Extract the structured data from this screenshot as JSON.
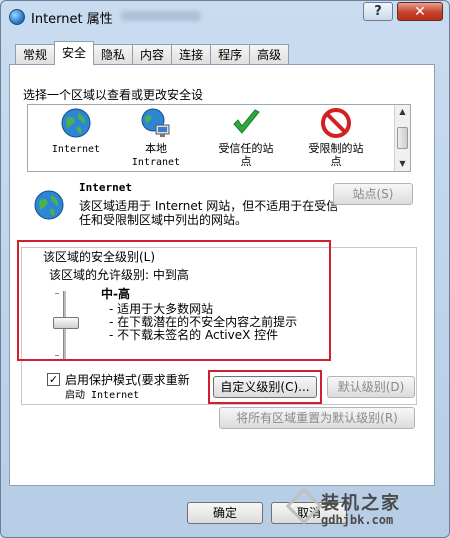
{
  "window": {
    "title": "Internet 属性"
  },
  "tabs": [
    {
      "label": "常规"
    },
    {
      "label": "安全"
    },
    {
      "label": "隐私"
    },
    {
      "label": "内容"
    },
    {
      "label": "连接"
    },
    {
      "label": "程序"
    },
    {
      "label": "高级"
    }
  ],
  "zones": {
    "prompt": "选择一个区域以查看或更改安全设",
    "items": [
      {
        "line1": "Internet",
        "line2": ""
      },
      {
        "line1": "本地",
        "line2": "Intranet"
      },
      {
        "line1": "受信任的站",
        "line2": "点"
      },
      {
        "line1": "受限制的站",
        "line2": "点"
      }
    ]
  },
  "zone_detail": {
    "title": "Internet",
    "text": "该区域适用于 Internet 网站，但不适用于在受信任和受限制区域中列出的网站。",
    "sites_button": "站点(S)"
  },
  "security_level": {
    "group_label": "该区域的安全级别(L)",
    "allowed": "该区域的允许级别: 中到高",
    "level": "中-高",
    "lines": [
      "适用于大多数网站",
      "在下载潜在的不安全内容之前提示",
      "不下载未签名的 ActiveX 控件"
    ]
  },
  "protected_mode": {
    "checked": true,
    "label_line1": "启用保护模式(要求重新",
    "label_line2": "启动 Internet"
  },
  "buttons": {
    "custom_level": "自定义级别(C)...",
    "default_level": "默认级别(D)",
    "reset_all": "将所有区域重置为默认级别(R)",
    "ok": "确定",
    "cancel": "取消"
  },
  "watermark": {
    "text": "装机之家",
    "url": "gdhjbk.com"
  }
}
